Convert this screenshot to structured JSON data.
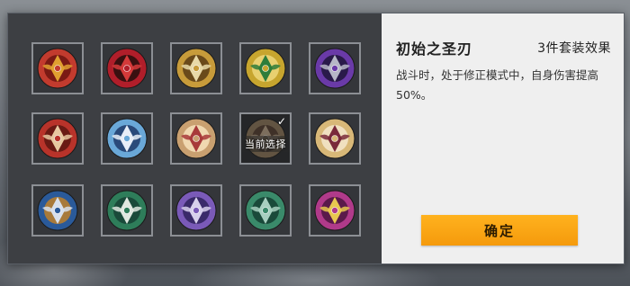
{
  "set_panel": {
    "title": "初始之圣刃",
    "effect_label": "3件套装效果",
    "description": "战斗时，处于修正模式中，自身伤害提高50%。",
    "confirm_label": "确定"
  },
  "emblem_grid": {
    "current_selection_label": "当前选择",
    "check_mark": "✓",
    "emblems": [
      {
        "name": "lion-emblem-icon",
        "ring": "#c23b2e",
        "core": "#e0a030",
        "accent": "#7a1a14"
      },
      {
        "name": "oni-mask-emblem-icon",
        "ring": "#b01e2a",
        "core": "#d43a3a",
        "accent": "#3a1010"
      },
      {
        "name": "golden-wings-emblem-icon",
        "ring": "#c79b3a",
        "core": "#e8d9a8",
        "accent": "#6a4a1a"
      },
      {
        "name": "green-phoenix-emblem-icon",
        "ring": "#c7a52e",
        "core": "#2e7d3a",
        "accent": "#e8d070"
      },
      {
        "name": "purple-tree-emblem-icon",
        "ring": "#6a3aa8",
        "core": "#b7b7c7",
        "accent": "#2a1a4a"
      },
      {
        "name": "red-fan-emblem-icon",
        "ring": "#b8332a",
        "core": "#e8c8a0",
        "accent": "#6a1a14"
      },
      {
        "name": "blue-crown-emblem-icon",
        "ring": "#6aa8d8",
        "core": "#e8eef8",
        "accent": "#2a4a7a"
      },
      {
        "name": "crimson-swirl-emblem-icon",
        "ring": "#c9a070",
        "core": "#a83a3a",
        "accent": "#f0d8b0"
      },
      {
        "name": "bronze-trident-emblem-icon",
        "ring": "#9a8060",
        "core": "#c8b090",
        "accent": "#5a4030"
      },
      {
        "name": "burgundy-ring-emblem-icon",
        "ring": "#d8b878",
        "core": "#7a2a3a",
        "accent": "#f0e0c0"
      },
      {
        "name": "blue-dragon-emblem-icon",
        "ring": "#2a5a9a",
        "core": "#d8e0ec",
        "accent": "#a87a3a"
      },
      {
        "name": "jade-gate-emblem-icon",
        "ring": "#2e7d5a",
        "core": "#e0e8e0",
        "accent": "#1a4a3a"
      },
      {
        "name": "violet-demon-emblem-icon",
        "ring": "#7a5ab8",
        "core": "#d8d0ec",
        "accent": "#3a2a6a"
      },
      {
        "name": "emerald-knot-emblem-icon",
        "ring": "#3a8a6a",
        "core": "#a8d0c0",
        "accent": "#1a4a3a"
      },
      {
        "name": "magenta-chalice-emblem-icon",
        "ring": "#b03a8a",
        "core": "#e8c850",
        "accent": "#5a1a4a"
      }
    ]
  }
}
